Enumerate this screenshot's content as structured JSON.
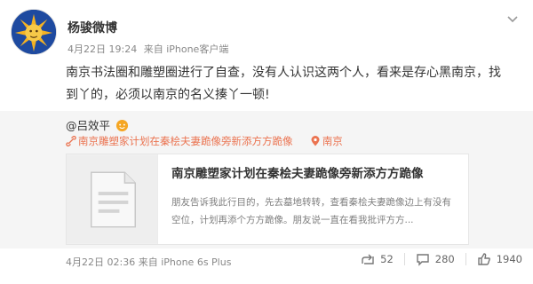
{
  "post": {
    "author": "杨骏微博",
    "date": "4月22日 19:24",
    "source": "来自 iPhone客户端",
    "text_line1": "南京书法圈和雕塑圈进行了自查，没有人认识这两个人，看来是存心黑南京，找",
    "text_line2": "到丫的，必须以南京的名义揍丫一顿!"
  },
  "repost": {
    "author": "@吕效平",
    "tags": [
      {
        "icon": "link-icon",
        "label": "南京雕塑家计划在秦桧夫妻跪像旁新添方方跪像"
      },
      {
        "icon": "location-icon",
        "label": "南京"
      }
    ],
    "article": {
      "title": "南京雕塑家计划在秦桧夫妻跪像旁新添方方跪像",
      "desc": "朋友告诉我此行目的，先去墓地转转，查看秦桧夫妻跪像边上有没有空位，计划再添个方方跪像。朋友说一直在看我批评方方..."
    },
    "date": "4月22日 02:36",
    "source": "来自 iPhone 6s Plus",
    "stats": {
      "reposts": "52",
      "comments": "280",
      "likes": "1940"
    }
  },
  "colors": {
    "accent": "#eb7350",
    "muted": "#888888",
    "repost_bg": "#f5f5f5"
  }
}
